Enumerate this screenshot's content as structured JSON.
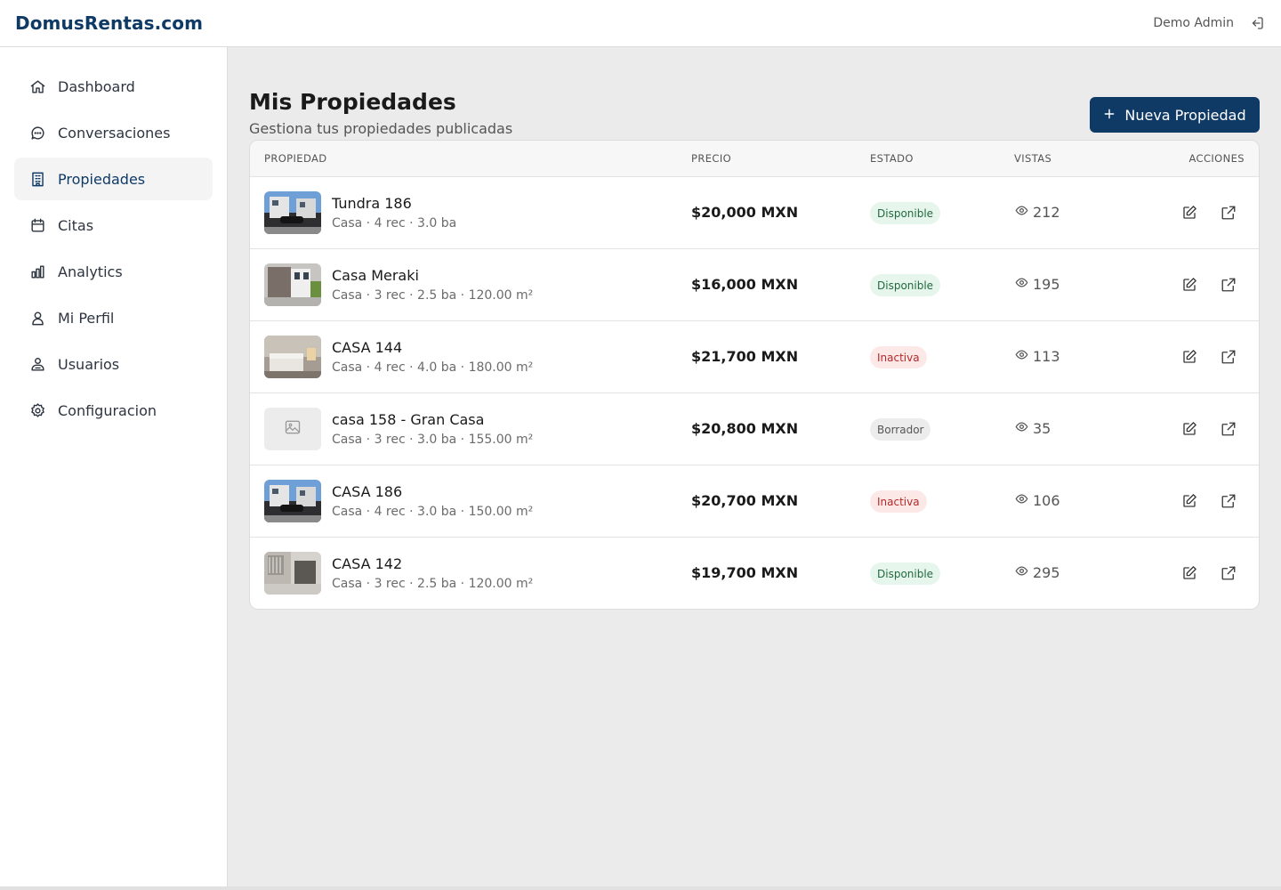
{
  "brand": "DomusRentas.com",
  "user": {
    "name": "Demo Admin"
  },
  "sidebar": {
    "items": [
      {
        "label": "Dashboard",
        "icon": "home-icon"
      },
      {
        "label": "Conversaciones",
        "icon": "chat-icon"
      },
      {
        "label": "Propiedades",
        "icon": "building-icon",
        "active": true
      },
      {
        "label": "Citas",
        "icon": "calendar-icon"
      },
      {
        "label": "Analytics",
        "icon": "bar-chart-icon"
      },
      {
        "label": "Mi Perfil",
        "icon": "user-icon"
      },
      {
        "label": "Usuarios",
        "icon": "users-icon"
      },
      {
        "label": "Configuracion",
        "icon": "gear-icon"
      }
    ]
  },
  "page": {
    "title": "Mis Propiedades",
    "subtitle": "Gestiona tus propiedades publicadas",
    "new_button_label": "Nueva Propiedad"
  },
  "table": {
    "columns": [
      "PROPIEDAD",
      "PRECIO",
      "ESTADO",
      "VISTAS",
      "ACCIONES"
    ],
    "rows": [
      {
        "name": "Tundra 186",
        "details": "Casa · 4 rec · 3.0 ba",
        "price": "$20,000 MXN",
        "status": "Disponible",
        "views": "212",
        "thumb": "house-exterior"
      },
      {
        "name": "Casa Meraki",
        "details": "Casa · 3 rec · 2.5 ba · 120.00 m²",
        "price": "$16,000 MXN",
        "status": "Disponible",
        "views": "195",
        "thumb": "house-facade"
      },
      {
        "name": "CASA 144",
        "details": "Casa · 4 rec · 4.0 ba · 180.00 m²",
        "price": "$21,700 MXN",
        "status": "Inactiva",
        "views": "113",
        "thumb": "bedroom"
      },
      {
        "name": "casa 158 - Gran Casa",
        "details": "Casa · 3 rec · 3.0 ba · 155.00 m²",
        "price": "$20,800 MXN",
        "status": "Borrador",
        "views": "35",
        "thumb": "placeholder"
      },
      {
        "name": "CASA 186",
        "details": "Casa · 4 rec · 3.0 ba · 150.00 m²",
        "price": "$20,700 MXN",
        "status": "Inactiva",
        "views": "106",
        "thumb": "house-exterior"
      },
      {
        "name": "CASA 142",
        "details": "Casa · 3 rec · 2.5 ba · 120.00 m²",
        "price": "$19,700 MXN",
        "status": "Disponible",
        "views": "295",
        "thumb": "interior"
      }
    ]
  },
  "colors": {
    "primary": "#0f3a66",
    "disponible_bg": "#e6f6ec",
    "inactiva_bg": "#fde8e8",
    "borrador_bg": "#ececec"
  }
}
